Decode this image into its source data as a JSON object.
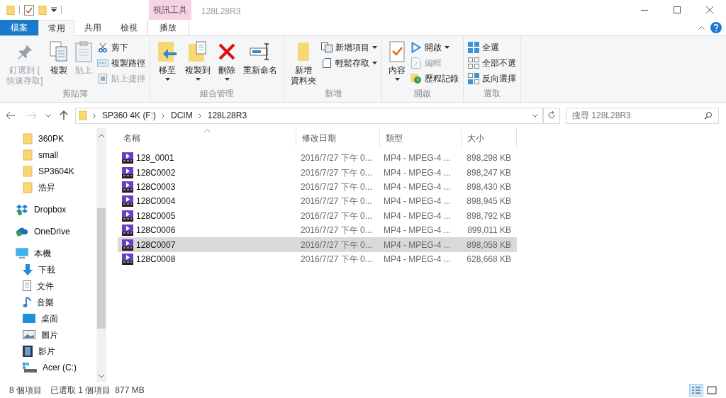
{
  "window": {
    "title": "128L28R3",
    "contextual_tab": "視訊工具"
  },
  "tabs": [
    {
      "label": "檔案",
      "kind": "file",
      "selected": false
    },
    {
      "label": "常用",
      "kind": "normal",
      "selected": true
    },
    {
      "label": "共用",
      "kind": "normal",
      "selected": false
    },
    {
      "label": "檢視",
      "kind": "normal",
      "selected": false
    },
    {
      "label": "播放",
      "kind": "contextual",
      "selected": false
    }
  ],
  "ribbon": [
    {
      "label": "剪貼簿",
      "items": [
        {
          "lines": [
            "釘選到 [",
            "快速存取]"
          ],
          "kind": "large",
          "disabled": true,
          "dropdown": false
        },
        {
          "label": "複製",
          "kind": "large",
          "disabled": false,
          "dropdown": false
        },
        {
          "label": "貼上",
          "kind": "large",
          "disabled": true,
          "dropdown": false
        },
        {
          "label": "剪下",
          "kind": "small",
          "disabled": false,
          "dropdown": false
        },
        {
          "label": "複製路徑",
          "kind": "small",
          "disabled": false,
          "dropdown": false
        },
        {
          "label": "貼上捷徑",
          "kind": "small",
          "disabled": true,
          "dropdown": false
        }
      ]
    },
    {
      "label": "組合管理",
      "items": [
        {
          "label": "移至",
          "kind": "large",
          "disabled": false,
          "dropdown": true
        },
        {
          "label": "複製到",
          "kind": "large",
          "disabled": false,
          "dropdown": true
        },
        {
          "label": "刪除",
          "kind": "large",
          "disabled": false,
          "dropdown": true
        },
        {
          "label": "重新命名",
          "kind": "large",
          "disabled": false,
          "dropdown": false
        }
      ]
    },
    {
      "label": "新增",
      "items": [
        {
          "lines": [
            "新增",
            "資料夾"
          ],
          "kind": "large",
          "disabled": false,
          "dropdown": false
        },
        {
          "label": "新增項目",
          "kind": "small",
          "disabled": false,
          "dropdown": true
        },
        {
          "label": "輕鬆存取",
          "kind": "small",
          "disabled": false,
          "dropdown": true
        }
      ]
    },
    {
      "label": "開啟",
      "items": [
        {
          "label": "內容",
          "kind": "large",
          "disabled": false,
          "dropdown": true
        },
        {
          "label": "開啟",
          "kind": "small",
          "disabled": false,
          "dropdown": true
        },
        {
          "label": "編輯",
          "kind": "small",
          "disabled": true,
          "dropdown": false
        },
        {
          "label": "歷程記錄",
          "kind": "small",
          "disabled": false,
          "dropdown": false
        }
      ]
    },
    {
      "label": "選取",
      "items": [
        {
          "label": "全選",
          "kind": "small",
          "disabled": false,
          "dropdown": false
        },
        {
          "label": "全部不選",
          "kind": "small",
          "disabled": false,
          "dropdown": false
        },
        {
          "label": "反向選擇",
          "kind": "small",
          "disabled": false,
          "dropdown": false
        }
      ]
    }
  ],
  "address": {
    "path": [
      "SP360 4K (F:)",
      "DCIM",
      "128L28R3"
    ]
  },
  "search": {
    "placeholder": "搜尋 128L28R3"
  },
  "nav": [
    {
      "children": [
        {
          "label": "360PK",
          "kind": "folder"
        },
        {
          "label": "small",
          "kind": "folder"
        },
        {
          "label": "SP3604K",
          "kind": "folder"
        },
        {
          "label": "浩昇",
          "kind": "folder"
        }
      ]
    },
    {
      "label": "Dropbox",
      "kind": "dropbox"
    },
    {
      "label": "OneDrive",
      "kind": "onedrive"
    },
    {
      "label": "本機",
      "kind": "pc",
      "children": [
        {
          "label": "下載",
          "kind": "download"
        },
        {
          "label": "文件",
          "kind": "documents"
        },
        {
          "label": "音樂",
          "kind": "music"
        },
        {
          "label": "桌面",
          "kind": "desktop"
        },
        {
          "label": "圖片",
          "kind": "pictures"
        },
        {
          "label": "影片",
          "kind": "videos"
        },
        {
          "label": "Acer (C:)",
          "kind": "drive"
        }
      ]
    }
  ],
  "columns": [
    {
      "label": "名稱",
      "sorted": true
    },
    {
      "label": "修改日期",
      "sorted": false
    },
    {
      "label": "類型",
      "sorted": false
    },
    {
      "label": "大小",
      "sorted": false
    }
  ],
  "files": [
    {
      "name": "128_0001",
      "date": "2016/7/27 下午 0...",
      "type": "MP4 - MPEG-4 ...",
      "size": "898,298 KB",
      "selected": false
    },
    {
      "name": "128C0002",
      "date": "2016/7/27 下午 0...",
      "type": "MP4 - MPEG-4 ...",
      "size": "898,247 KB",
      "selected": false
    },
    {
      "name": "128C0003",
      "date": "2016/7/27 下午 0...",
      "type": "MP4 - MPEG-4 ...",
      "size": "898,430 KB",
      "selected": false
    },
    {
      "name": "128C0004",
      "date": "2016/7/27 下午 0...",
      "type": "MP4 - MPEG-4 ...",
      "size": "898,945 KB",
      "selected": false
    },
    {
      "name": "128C0005",
      "date": "2016/7/27 下午 0...",
      "type": "MP4 - MPEG-4 ...",
      "size": "898,792 KB",
      "selected": false
    },
    {
      "name": "128C0006",
      "date": "2016/7/27 下午 0...",
      "type": "MP4 - MPEG-4 ...",
      "size": "899,011 KB",
      "selected": false
    },
    {
      "name": "128C0007",
      "date": "2016/7/27 下午 0...",
      "type": "MP4 - MPEG-4 ...",
      "size": "898,058 KB",
      "selected": true
    },
    {
      "name": "128C0008",
      "date": "2016/7/27 下午 0...",
      "type": "MP4 - MPEG-4 ...",
      "size": "628,668 KB",
      "selected": false
    }
  ],
  "status_bar": {
    "count": "8 個項目",
    "selection": "已選取 1 個項目",
    "size": "877 MB"
  },
  "view_buttons": [
    {
      "kind": "details",
      "selected": true
    },
    {
      "kind": "large_icons",
      "selected": false
    }
  ]
}
